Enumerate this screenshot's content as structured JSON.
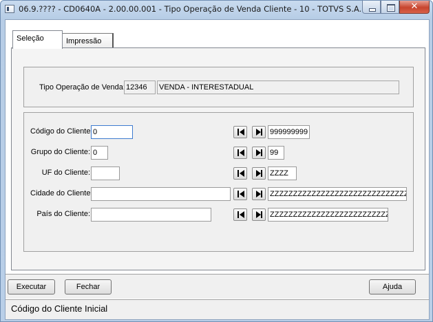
{
  "window": {
    "title": "06.9.???? - CD0640A - 2.00.00.001 - Tipo Operação de Venda Cliente - 10 - TOTVS S.A.",
    "close_glyph": "✕"
  },
  "tabs": [
    {
      "label": "Seleção",
      "active": true
    },
    {
      "label": "Impressão",
      "active": false
    }
  ],
  "operation": {
    "label": "Tipo Operação de Venda:",
    "code": "12346",
    "description": "VENDA - INTERESTADUAL"
  },
  "filters": [
    {
      "label": "Código do Cliente:",
      "from": "0",
      "to": "999999999"
    },
    {
      "label": "Grupo do Cliente:",
      "from": "0",
      "to": "99"
    },
    {
      "label": "UF do Cliente:",
      "from": "",
      "to": "ZZZZ"
    },
    {
      "label": "Cidade do Cliente:",
      "from": "",
      "to": "ZZZZZZZZZZZZZZZZZZZZZZZZZZZZZZZZZZZZZZ"
    },
    {
      "label": "País do Cliente:",
      "from": "",
      "to": "ZZZZZZZZZZZZZZZZZZZZZZZZZZZZZZZZZZZZZ"
    }
  ],
  "buttons": {
    "execute": "Executar",
    "close": "Fechar",
    "help": "Ajuda"
  },
  "status": {
    "text": "Código do Cliente Inicial"
  }
}
